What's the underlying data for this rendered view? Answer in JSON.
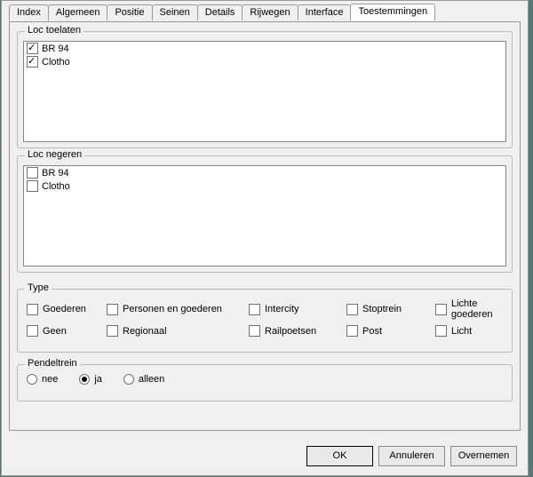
{
  "tabs": [
    "Index",
    "Algemeen",
    "Positie",
    "Seinen",
    "Details",
    "Rijwegen",
    "Interface",
    "Toestemmingen"
  ],
  "active_tab": 7,
  "allow": {
    "title": "Loc toelaten",
    "items": [
      {
        "label": "BR 94",
        "checked": true
      },
      {
        "label": "Clotho",
        "checked": true
      }
    ]
  },
  "ignore": {
    "title": "Loc negeren",
    "items": [
      {
        "label": "BR 94",
        "checked": false
      },
      {
        "label": "Clotho",
        "checked": false
      }
    ]
  },
  "type": {
    "title": "Type",
    "row1": [
      {
        "label": "Goederen",
        "checked": false
      },
      {
        "label": "Personen en goederen",
        "checked": false
      },
      {
        "label": "Intercity",
        "checked": false
      },
      {
        "label": "Stoptrein",
        "checked": false
      },
      {
        "label": "Lichte goederen",
        "checked": false
      }
    ],
    "row2": [
      {
        "label": "Geen",
        "checked": false
      },
      {
        "label": "Regionaal",
        "checked": false
      },
      {
        "label": "Railpoetsen",
        "checked": false
      },
      {
        "label": "Post",
        "checked": false
      },
      {
        "label": "Licht",
        "checked": false
      }
    ]
  },
  "shuttle": {
    "title": "Pendeltrein",
    "options": [
      {
        "label": "nee",
        "selected": false
      },
      {
        "label": "ja",
        "selected": true
      },
      {
        "label": "alleen",
        "selected": false
      }
    ]
  },
  "buttons": {
    "ok": "OK",
    "cancel": "Annuleren",
    "apply": "Overnemen"
  }
}
